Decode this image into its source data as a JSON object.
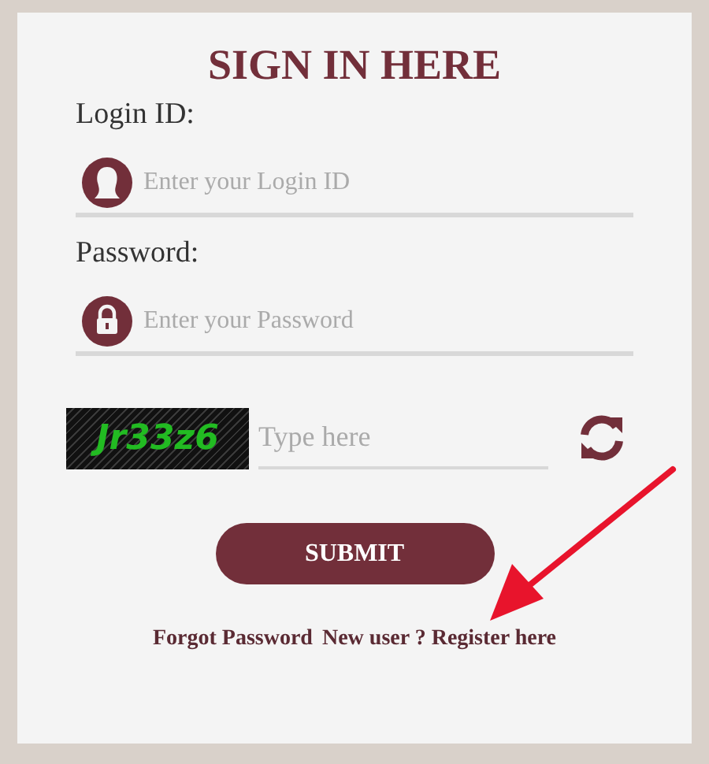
{
  "title": "SIGN IN HERE",
  "fields": [
    {
      "label": "Login ID:",
      "placeholder": "Enter your Login ID",
      "kind": "user"
    },
    {
      "label": "Password:",
      "placeholder": "Enter your Password",
      "kind": "lock"
    }
  ],
  "captcha": {
    "text": "Jr33z6",
    "placeholder": "Type here"
  },
  "submit": "SUBMIT",
  "links": [
    "Forgot Password",
    "New user ? Register here"
  ]
}
